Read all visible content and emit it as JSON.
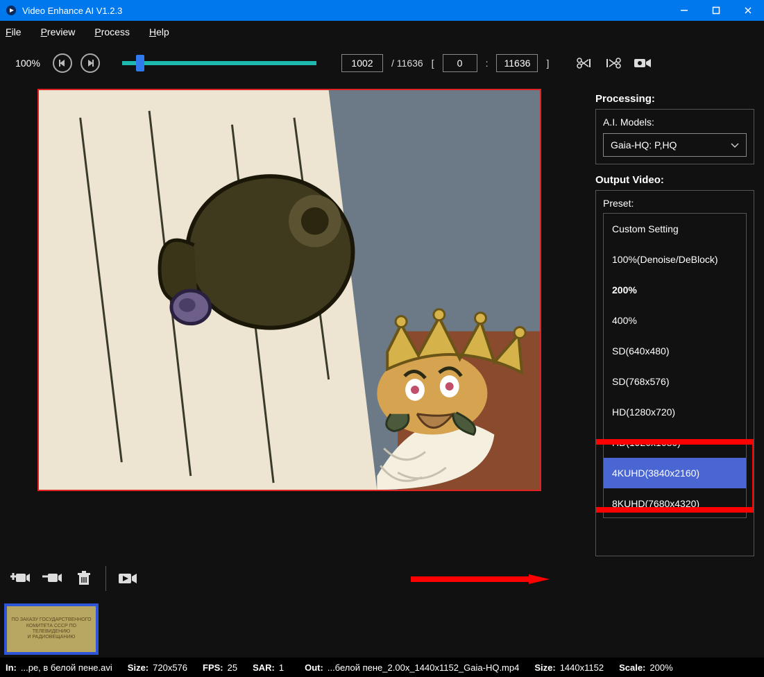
{
  "titlebar": {
    "title": "Video Enhance AI V1.2.3"
  },
  "menubar": [
    "File",
    "Preview",
    "Process",
    "Help"
  ],
  "toolbar": {
    "zoom": "100%",
    "current_frame": "1002",
    "total_frames": "/ 11636",
    "range_start": "0",
    "range_sep": ":",
    "range_end": "11636"
  },
  "side": {
    "processing_title": "Processing:",
    "ai_models_label": "A.I. Models:",
    "ai_model_value": "Gaia-HQ: P,HQ",
    "output_title": "Output Video:",
    "preset_label": "Preset:",
    "presets": [
      "Custom Setting",
      "100%(Denoise/DeBlock)",
      "200%",
      "400%",
      "SD(640x480)",
      "SD(768x576)",
      "HD(1280x720)",
      "HD(1920x1080)",
      "4KUHD(3840x2160)",
      "8KUHD(7680x4320)"
    ]
  },
  "clip_thumb": {
    "l1": "ПО ЗАКАЗУ ГОСУДАРСТВЕННОГО",
    "l2": "КОМИТЕТА СССР ПО ТЕЛЕВИДЕНИЮ",
    "l3": "И РАДИОВЕЩАНИЮ"
  },
  "status": {
    "in_lbl": "In:",
    "in_val": "...ре, в белой пене.avi",
    "size_lbl": "Size:",
    "size_val": "720x576",
    "fps_lbl": "FPS:",
    "fps_val": "25",
    "sar_lbl": "SAR:",
    "sar_val": "1",
    "out_lbl": "Out:",
    "out_val": "...белой пене_2.00x_1440x1152_Gaia-HQ.mp4",
    "osize_lbl": "Size:",
    "osize_val": "1440x1152",
    "scale_lbl": "Scale:",
    "scale_val": "200%"
  }
}
